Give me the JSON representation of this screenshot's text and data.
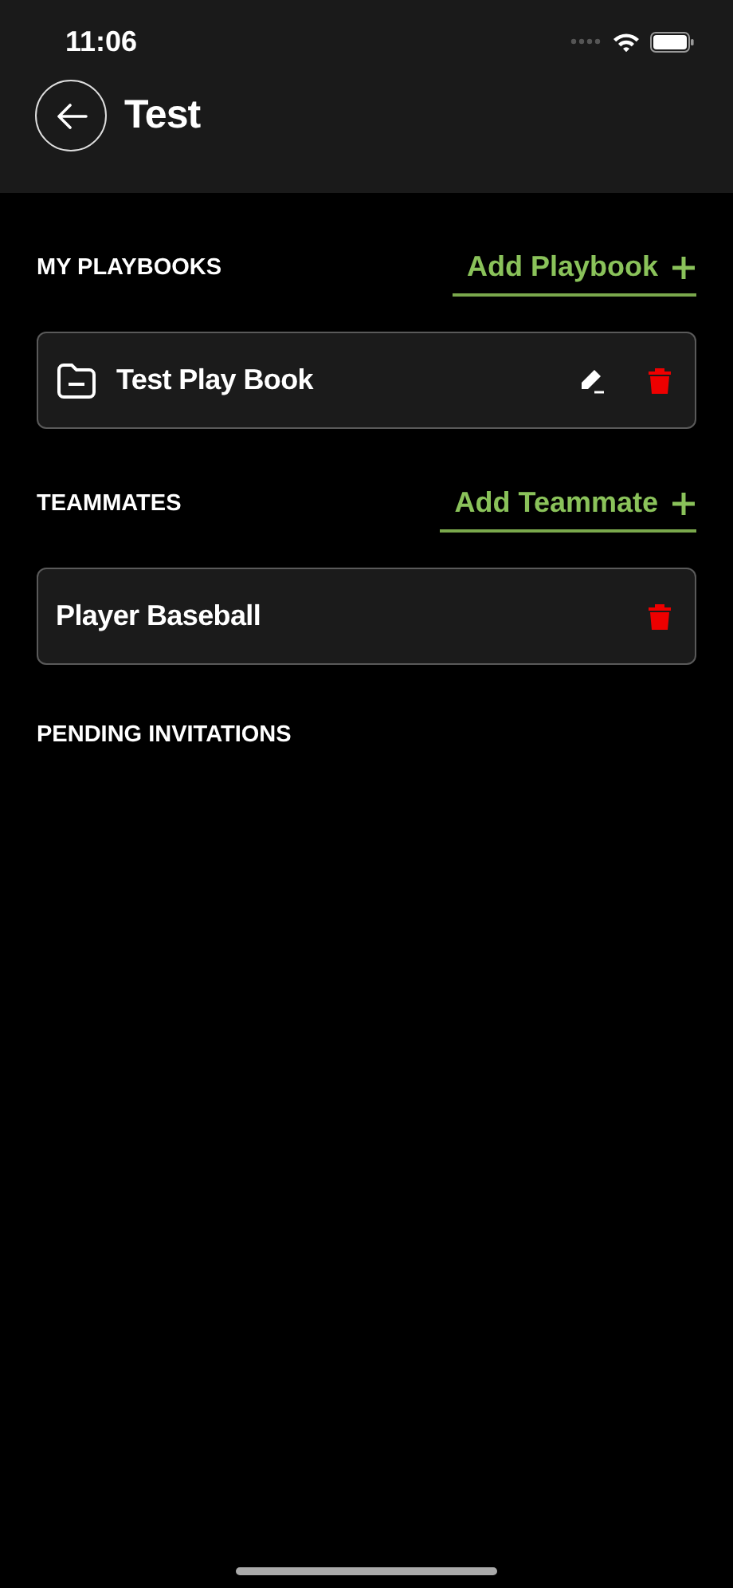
{
  "status_bar": {
    "time": "11:06"
  },
  "header": {
    "title": "Test"
  },
  "sections": [
    {
      "title": "MY PLAYBOOKS",
      "action": "Add Playbook",
      "items": [
        {
          "kind": "playbook",
          "name": "Test Play Book"
        }
      ]
    },
    {
      "title": "TEAMMATES",
      "action": "Add Teammate",
      "items": [
        {
          "kind": "person",
          "name": "Player Baseball"
        }
      ]
    },
    {
      "title": "PENDING INVITATIONS"
    }
  ]
}
